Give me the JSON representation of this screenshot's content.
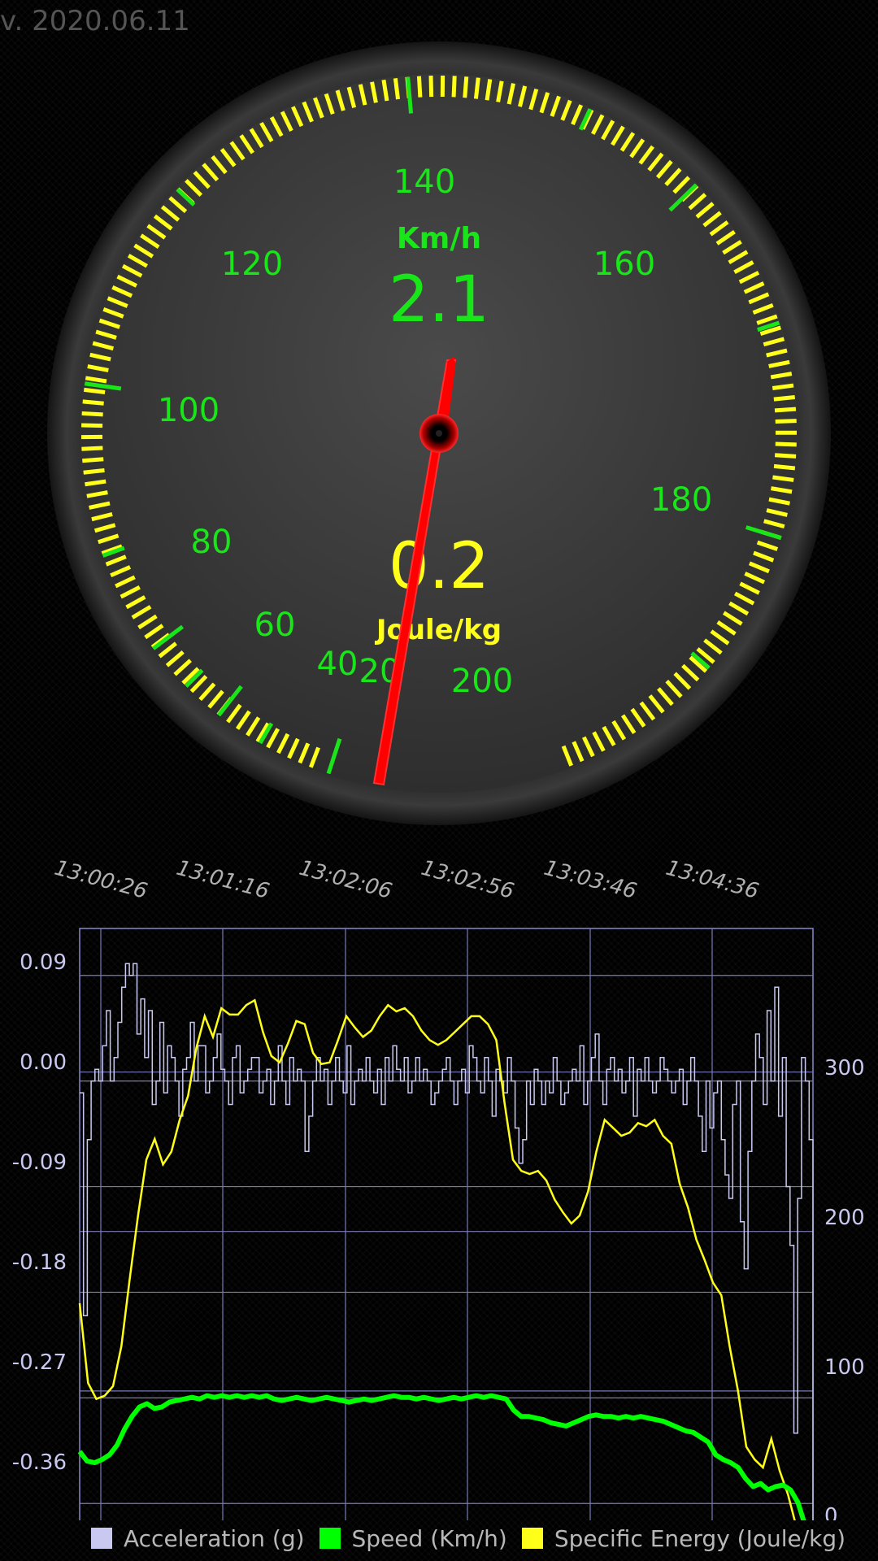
{
  "version": "v. 2020.06.11",
  "gauge": {
    "speed_unit": "Km/h",
    "speed_value": "2.1",
    "energy_value": "0.2",
    "energy_unit": "Joule/kg",
    "scale_labels": [
      "20",
      "40",
      "60",
      "80",
      "100",
      "120",
      "140",
      "160",
      "180",
      "200"
    ],
    "needle_speed": 2.1,
    "colors": {
      "ticks": "#ffff1a",
      "labels": "#19e619",
      "needle": "#ff0000",
      "energy": "#ffff1a"
    }
  },
  "chart_data": {
    "type": "line",
    "x_ticks": [
      "13:00:26",
      "13:01:16",
      "13:02:06",
      "13:02:56",
      "13:03:46",
      "13:04:36"
    ],
    "left_axis": {
      "ticks": [
        "0.09",
        "0.00",
        "-0.09",
        "-0.18",
        "-0.27",
        "-0.36"
      ],
      "ylim": [
        -0.4,
        0.13
      ]
    },
    "right_axis": {
      "ticks": [
        "300",
        "200",
        "100",
        "0"
      ],
      "ylim": [
        0,
        390
      ]
    },
    "grid": true,
    "legend_position": "bottom",
    "series": [
      {
        "name": "Acceleration (g)",
        "color": "#c8c8f0",
        "axis": "left",
        "values": [
          -0.01,
          -0.2,
          -0.05,
          0.0,
          0.01,
          0.0,
          0.03,
          0.06,
          0.0,
          0.02,
          0.05,
          0.08,
          0.1,
          0.09,
          0.1,
          0.04,
          0.07,
          0.02,
          0.06,
          -0.02,
          0.0,
          0.05,
          -0.01,
          0.03,
          0.02,
          0.0,
          -0.03,
          0.01,
          0.02,
          0.05,
          0.0,
          0.03,
          0.03,
          -0.01,
          0.0,
          0.02,
          0.04,
          0.01,
          0.0,
          -0.02,
          0.02,
          0.03,
          -0.01,
          0.0,
          0.01,
          0.02,
          0.02,
          -0.01,
          0.0,
          0.01,
          -0.02,
          0.0,
          0.03,
          0.0,
          -0.02,
          0.02,
          0.0,
          0.01,
          0.0,
          -0.06,
          -0.03,
          0.0,
          0.02,
          0.0,
          0.01,
          -0.02,
          0.0,
          0.02,
          0.0,
          -0.01,
          0.03,
          -0.02,
          0.0,
          0.01,
          0.0,
          0.02,
          0.0,
          -0.01,
          0.01,
          -0.02,
          0.02,
          0.0,
          0.03,
          0.01,
          0.0,
          0.02,
          -0.01,
          0.0,
          0.02,
          0.0,
          0.01,
          0.0,
          -0.02,
          -0.01,
          0.0,
          0.01,
          0.02,
          0.0,
          -0.02,
          0.0,
          0.01,
          -0.01,
          0.03,
          0.02,
          0.0,
          -0.01,
          0.02,
          0.0,
          -0.03,
          0.01,
          0.0,
          -0.01,
          0.02,
          0.0,
          -0.04,
          -0.07,
          -0.05,
          0.0,
          -0.02,
          0.01,
          0.0,
          -0.02,
          0.0,
          -0.01,
          0.02,
          0.0,
          -0.02,
          -0.01,
          0.0,
          0.01,
          0.0,
          0.03,
          -0.02,
          0.0,
          0.02,
          0.04,
          0.0,
          -0.02,
          0.01,
          0.02,
          0.0,
          0.01,
          -0.01,
          0.0,
          0.02,
          -0.03,
          0.01,
          0.0,
          0.02,
          0.0,
          -0.01,
          0.0,
          0.02,
          0.01,
          0.0,
          -0.01,
          0.0,
          0.01,
          -0.02,
          0.0,
          0.02,
          0.0,
          -0.03,
          -0.06,
          0.0,
          -0.04,
          -0.01,
          0.0,
          -0.05,
          -0.08,
          -0.1,
          -0.02,
          0.0,
          -0.12,
          -0.16,
          -0.06,
          0.0,
          0.04,
          0.02,
          -0.02,
          0.06,
          0.0,
          0.08,
          -0.03,
          0.02,
          -0.09,
          -0.14,
          -0.3,
          -0.1,
          0.02,
          0.0,
          -0.05,
          -0.38
        ]
      },
      {
        "name": "Speed (Km/h)",
        "color": "#00ff00",
        "axis": "right",
        "values": [
          62,
          56,
          55,
          57,
          60,
          66,
          76,
          84,
          90,
          92,
          89,
          90,
          93,
          94,
          95,
          96,
          95,
          97,
          96,
          97,
          96,
          97,
          96,
          97,
          96,
          97,
          95,
          94,
          95,
          96,
          95,
          94,
          95,
          96,
          95,
          94,
          93,
          94,
          95,
          94,
          95,
          96,
          97,
          96,
          96,
          95,
          96,
          95,
          94,
          95,
          96,
          95,
          96,
          97,
          96,
          97,
          96,
          95,
          88,
          84,
          84,
          83,
          82,
          80,
          79,
          78,
          80,
          82,
          84,
          85,
          84,
          84,
          83,
          84,
          83,
          84,
          83,
          82,
          81,
          79,
          77,
          75,
          74,
          71,
          68,
          60,
          57,
          55,
          52,
          45,
          40,
          42,
          38,
          40,
          41,
          38,
          30,
          15,
          2
        ]
      },
      {
        "name": "Specific Energy (Joule/kg)",
        "color": "#ffff1a",
        "axis": "right",
        "values": [
          155,
          105,
          95,
          97,
          103,
          128,
          170,
          210,
          245,
          258,
          242,
          250,
          270,
          285,
          315,
          335,
          322,
          340,
          336,
          336,
          342,
          345,
          325,
          310,
          306,
          318,
          332,
          330,
          312,
          305,
          306,
          320,
          335,
          328,
          322,
          326,
          335,
          342,
          338,
          340,
          335,
          326,
          320,
          317,
          320,
          325,
          330,
          335,
          335,
          330,
          320,
          280,
          245,
          238,
          236,
          238,
          232,
          220,
          212,
          205,
          210,
          225,
          250,
          270,
          265,
          260,
          262,
          268,
          266,
          270,
          260,
          255,
          230,
          215,
          195,
          182,
          168,
          160,
          128,
          100,
          65,
          57,
          52,
          70,
          50,
          35,
          15,
          5,
          2
        ]
      }
    ]
  },
  "legend": [
    {
      "label": "Acceleration (g)",
      "color": "#c8c8f0"
    },
    {
      "label": "Speed (Km/h)",
      "color": "#00ff00"
    },
    {
      "label": "Specific Energy (Joule/kg)",
      "color": "#ffff1a"
    }
  ]
}
